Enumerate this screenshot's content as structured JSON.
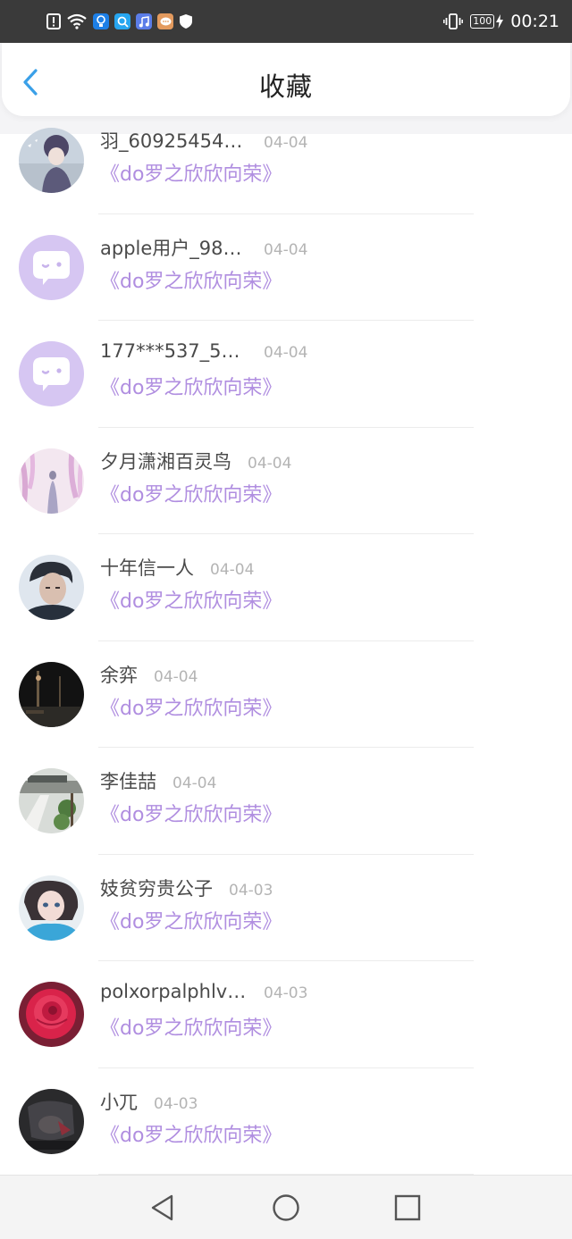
{
  "status_bar": {
    "time": "00:21",
    "battery": "100",
    "left_icons": [
      "alert-icon",
      "wifi-icon",
      "app-bulb-icon",
      "app-search-icon",
      "app-music-icon",
      "app-chat-icon",
      "shield-icon"
    ],
    "right_icons": [
      "vibrate-icon",
      "battery-icon",
      "charging-icon"
    ]
  },
  "header": {
    "title": "收藏",
    "back_icon": "chevron-left-icon"
  },
  "colors": {
    "accent": "#3aa0e8",
    "book_link": "#b08ee0",
    "status_bar_bg": "#3a3a3a",
    "avatar_placeholder_bg": "#d6c6f2"
  },
  "items": [
    {
      "name": "羽_609254549...",
      "date": "04-04",
      "book": "《do罗之欣欣向荣》",
      "avatar": "anime-boy-avatar"
    },
    {
      "name": "apple用户_988...",
      "date": "04-04",
      "book": "《do罗之欣欣向荣》",
      "avatar": "default-chat-avatar"
    },
    {
      "name": "177***537_571...",
      "date": "04-04",
      "book": "《do罗之欣欣向荣》",
      "avatar": "default-chat-avatar"
    },
    {
      "name": "夕月潇湘百灵鸟",
      "date": "04-04",
      "book": "《do罗之欣欣向荣》",
      "avatar": "wisteria-avatar"
    },
    {
      "name": "十年信一人",
      "date": "04-04",
      "book": "《do罗之欣欣向荣》",
      "avatar": "portrait-avatar"
    },
    {
      "name": "余弈",
      "date": "04-04",
      "book": "《do罗之欣欣向荣》",
      "avatar": "night-city-avatar"
    },
    {
      "name": "李佳喆",
      "date": "04-04",
      "book": "《do罗之欣欣向荣》",
      "avatar": "street-avatar"
    },
    {
      "name": "妓贫穷贵公子",
      "date": "04-03",
      "book": "《do罗之欣欣向荣》",
      "avatar": "girl-avatar"
    },
    {
      "name": "polxorpalphlva...",
      "date": "04-03",
      "book": "《do罗之欣欣向荣》",
      "avatar": "rose-avatar"
    },
    {
      "name": "小兀",
      "date": "04-03",
      "book": "《do罗之欣欣向荣》",
      "avatar": "dark-photo-avatar"
    }
  ],
  "nav_bar": {
    "back": "triangle-back-icon",
    "home": "circle-home-icon",
    "recents": "square-recents-icon"
  }
}
